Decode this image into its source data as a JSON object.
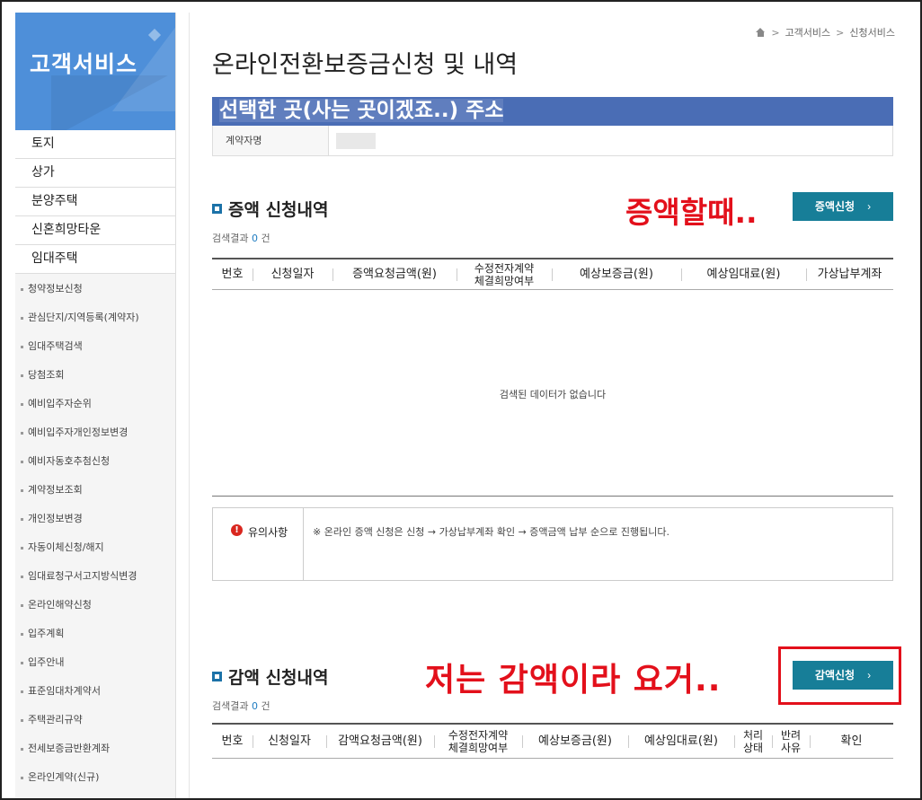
{
  "sidebar": {
    "title": "고객서비스",
    "main_items": [
      "토지",
      "상가",
      "분양주택",
      "신혼희망타운",
      "임대주택"
    ],
    "sub_items": [
      "청약정보신청",
      "관심단지/지역등록(계약자)",
      "임대주택검색",
      "당첨조회",
      "예비입주자순위",
      "예비입주자개인정보변경",
      "예비자동호추첨신청",
      "계약정보조회",
      "개인정보변경",
      "자동이체신청/해지",
      "임대료청구서고지방식변경",
      "온라인해약신청",
      "입주계획",
      "입주안내",
      "표준임대차계약서",
      "주택관리규약",
      "전세보증금반환계좌",
      "온라인계약(신규)"
    ]
  },
  "breadcrumb": {
    "items": [
      "고객서비스",
      "신청서비스"
    ],
    "separator": ">"
  },
  "page_title": "온라인전환보증금신청 및 내역",
  "address_overlay": "선택한 곳(사는 곳이겠죠..) 주소",
  "contract": {
    "label": "계약자명"
  },
  "increase": {
    "title": "증액 신청내역",
    "count_prefix": "검색결과",
    "count": "0",
    "count_suffix": "건",
    "button_label": "증액신청",
    "button_chevron": "›",
    "annotation": "증액할때..",
    "columns": [
      {
        "label": "번호"
      },
      {
        "label": "신청일자"
      },
      {
        "label": "증액요청금액(원)"
      },
      {
        "label": "수정전자계약",
        "label2": "체결희망여부"
      },
      {
        "label": "예상보증금(원)"
      },
      {
        "label": "예상임대료(원)"
      },
      {
        "label": "가상납부계좌"
      }
    ],
    "empty_message": "검색된 데이터가 없습니다"
  },
  "notice": {
    "icon_text": "!",
    "label": "유의사항",
    "text": "※ 온라인 증액 신청은 신청 → 가상납부계좌 확인 → 증액금액 납부 순으로 진행됩니다."
  },
  "decrease": {
    "title": "감액 신청내역",
    "count_prefix": "검색결과",
    "count": "0",
    "count_suffix": "건",
    "button_label": "감액신청",
    "button_chevron": "›",
    "annotation": "저는 감액이라 요거..",
    "columns": [
      {
        "label": "번호"
      },
      {
        "label": "신청일자"
      },
      {
        "label": "감액요청금액(원)"
      },
      {
        "label": "수정전자계약",
        "label2": "체결희망여부"
      },
      {
        "label": "예상보증금(원)"
      },
      {
        "label": "예상임대료(원)"
      },
      {
        "label": "처리",
        "label2": "상태"
      },
      {
        "label": "반려",
        "label2": "사유"
      },
      {
        "label": "확인"
      }
    ]
  },
  "colors": {
    "accent": "#177e98",
    "sidebar_header": "#4e8fd9",
    "annotation": "#e3101b",
    "address_bar": "#4a6db5"
  }
}
